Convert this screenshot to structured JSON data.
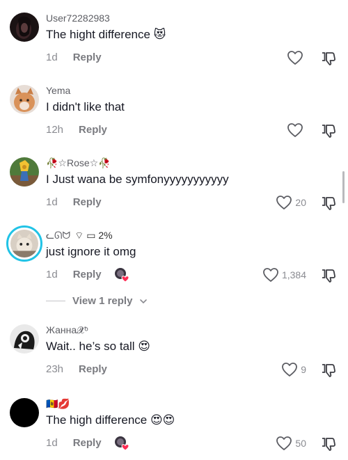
{
  "comments": [
    {
      "username": "User72282983",
      "text": "The hight difference 😻",
      "time": "1d",
      "reply_label": "Reply",
      "likes": ""
    },
    {
      "username": "Yema",
      "text": "I didn't like that",
      "time": "12h",
      "reply_label": "Reply",
      "likes": ""
    },
    {
      "username": "🥀☆Rose☆🥀",
      "text": "I Just wana be symfonyyyyyyyyyyy",
      "time": "1d",
      "reply_label": "Reply",
      "likes": "20"
    },
    {
      "username": "ᓚᘏᗢ",
      "status": "⌔ ▭ 2%",
      "text": "just ignore it omg",
      "time": "1d",
      "reply_label": "Reply",
      "likes": "1,384"
    },
    {
      "username": "Жанна𝓧ᵒ",
      "text": "Wait.. he’s so tall 😍",
      "time": "23h",
      "reply_label": "Reply",
      "likes": "9"
    },
    {
      "username": "🇲🇩💋",
      "text": "The high difference 😍😍",
      "time": "1d",
      "reply_label": "Reply",
      "likes": "50"
    }
  ],
  "view_replies": {
    "label": "View 1 reply"
  },
  "colors": {
    "accent_ring": "#21c3e6",
    "heart_badge": "#fe2c55",
    "muted_text": "#8a8b91"
  }
}
